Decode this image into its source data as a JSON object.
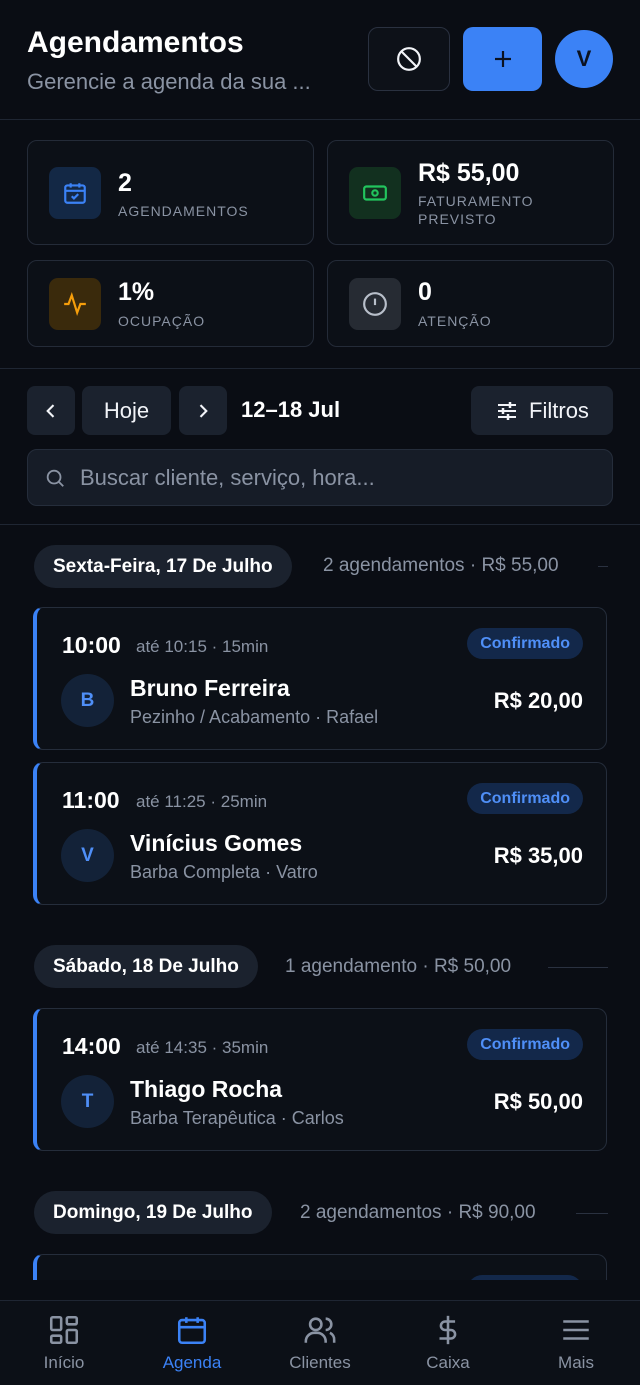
{
  "header": {
    "title": "Agendamentos",
    "subtitle": "Gerencie a agenda da sua ...",
    "avatar_initial": "V"
  },
  "stats": [
    {
      "value": "2",
      "label": "AGENDAMENTOS",
      "icon": "calendar-check-icon",
      "color": "#3b82f6"
    },
    {
      "value": "R$ 55,00",
      "label": "FATURAMENTO PREVISTO",
      "icon": "money-icon",
      "color": "#22c55e"
    },
    {
      "value": "1%",
      "label": "OCUPAÇÃO",
      "icon": "activity-icon",
      "color": "#f59e0b"
    },
    {
      "value": "0",
      "label": "ATENÇÃO",
      "icon": "alert-circle-icon",
      "color": "#9ca3af"
    }
  ],
  "toolbar": {
    "today_label": "Hoje",
    "range_label": "12–18 Jul",
    "filters_label": "Filtros"
  },
  "search": {
    "placeholder": "Buscar cliente, serviço, hora..."
  },
  "days": [
    {
      "title": "Sexta-Feira, 17 De Julho",
      "meta": "2 agendamentos · R$ 55,00",
      "appointments": [
        {
          "time": "10:00",
          "until": "até 10:15 · 15min",
          "status": "Confirmado",
          "initial": "B",
          "client": "Bruno Ferreira",
          "service": "Pezinho / Acabamento · Rafael",
          "price": "R$ 20,00"
        },
        {
          "time": "11:00",
          "until": "até 11:25 · 25min",
          "status": "Confirmado",
          "initial": "V",
          "client": "Vinícius Gomes",
          "service": "Barba Completa · Vatro",
          "price": "R$ 35,00"
        }
      ]
    },
    {
      "title": "Sábado, 18 De Julho",
      "meta": "1 agendamento · R$ 50,00",
      "appointments": [
        {
          "time": "14:00",
          "until": "até 14:35 · 35min",
          "status": "Confirmado",
          "initial": "T",
          "client": "Thiago Rocha",
          "service": "Barba Terapêutica · Carlos",
          "price": "R$ 50,00"
        }
      ]
    },
    {
      "title": "Domingo, 19 De Julho",
      "meta": "2 agendamentos · R$ 90,00",
      "appointments": []
    }
  ],
  "nav": [
    {
      "label": "Início",
      "icon": "grid-icon",
      "active": false
    },
    {
      "label": "Agenda",
      "icon": "calendar-icon",
      "active": true
    },
    {
      "label": "Clientes",
      "icon": "users-icon",
      "active": false
    },
    {
      "label": "Caixa",
      "icon": "dollar-icon",
      "active": false
    },
    {
      "label": "Mais",
      "icon": "menu-icon",
      "active": false
    }
  ],
  "colors": {
    "accent": "#3b82f6",
    "background": "#0a0d14"
  }
}
